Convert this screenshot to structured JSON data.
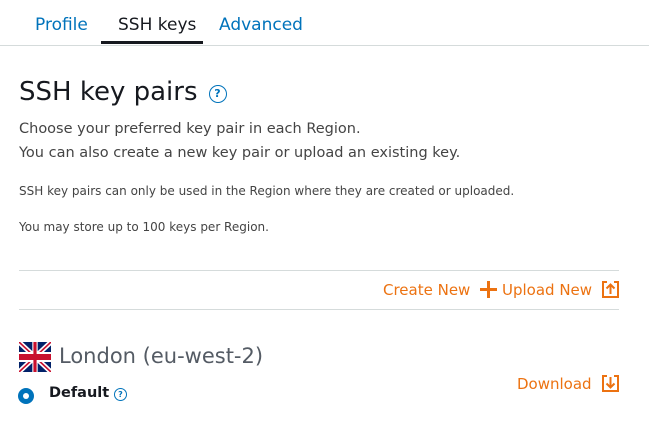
{
  "tabs": [
    {
      "label": "Profile",
      "active": false
    },
    {
      "label": "SSH keys",
      "active": true
    },
    {
      "label": "Advanced",
      "active": false
    }
  ],
  "section": {
    "title": "SSH key pairs",
    "help_icon": "question-circle-icon",
    "description_line1": "Choose your preferred key pair in each Region.",
    "description_line2": "You can also create a new key pair or upload an existing key.",
    "note_region": "SSH key pairs can only be used in the Region where they are created or uploaded.",
    "note_limit": "You may store up to 100 keys per Region."
  },
  "actions": {
    "create_new_label": "Create New",
    "create_new_icon": "plus-icon",
    "upload_new_label": "Upload New",
    "upload_new_icon": "upload-icon"
  },
  "region": {
    "flag_icon": "uk-flag-icon",
    "name": "London (eu-west-2)",
    "key_label": "Default",
    "key_selected": true,
    "download_label": "Download",
    "download_icon": "download-icon"
  },
  "colors": {
    "link_blue": "#0073bb",
    "accent_orange": "#ec7211",
    "text_dark": "#16191f",
    "divider": "#d5dbdb"
  }
}
